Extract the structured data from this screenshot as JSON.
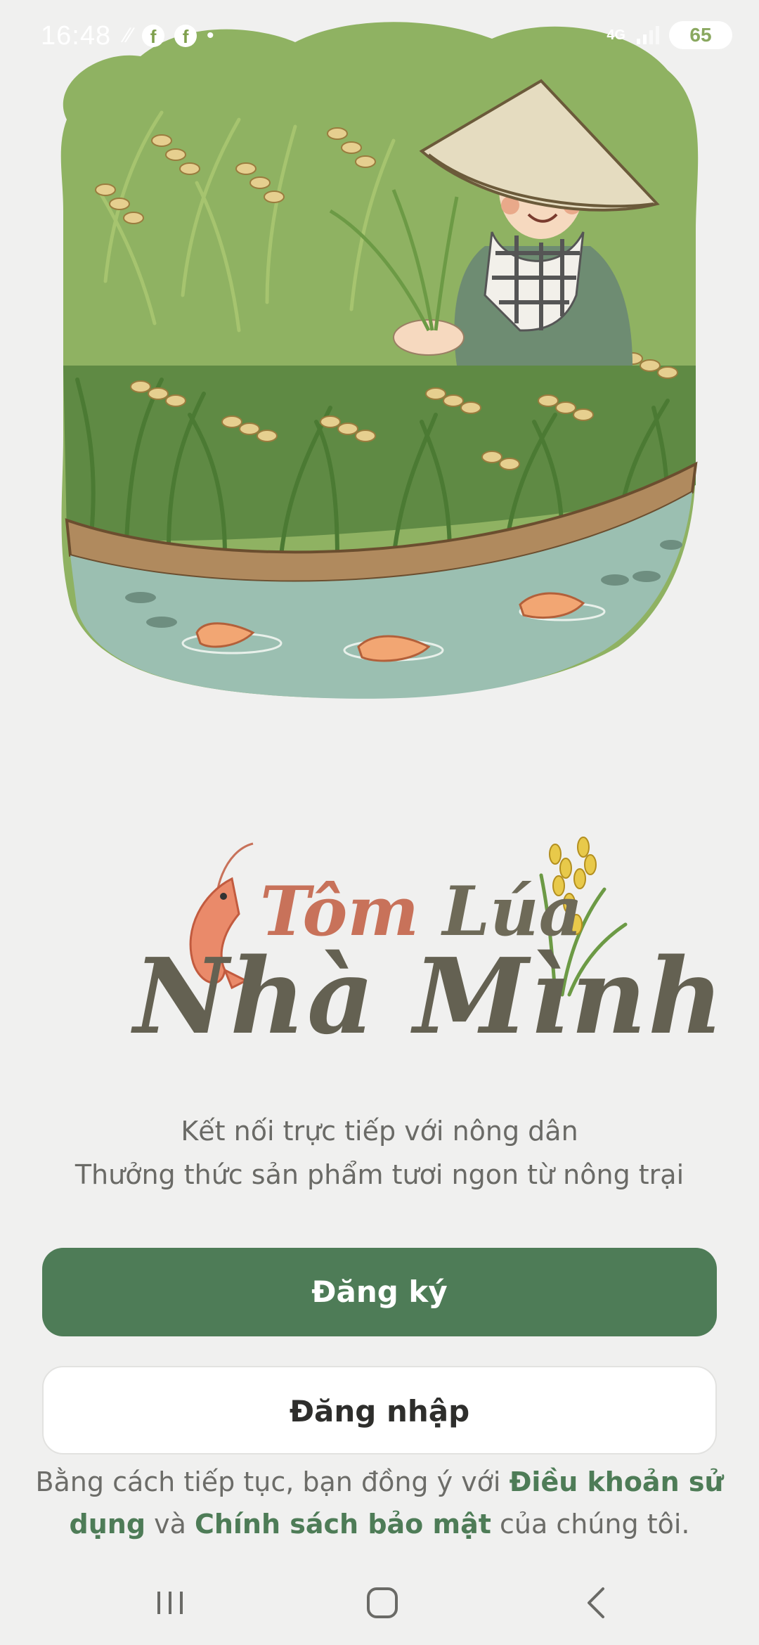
{
  "status_bar": {
    "time": "16:48",
    "network_label": "4G",
    "battery": "65",
    "icons": [
      "data-icon",
      "facebook-icon",
      "facebook-icon",
      "dot-icon",
      "signal-icon",
      "battery-icon"
    ]
  },
  "hero": {
    "illustration": "farmer-rice-field-shrimp-illustration"
  },
  "logo": {
    "line1_word1": "Tôm",
    "line1_word2": "Lúa",
    "line2": "Nhà Mình"
  },
  "tagline": {
    "line1": "Kết nối trực tiếp với nông dân",
    "line2": "Thưởng thức sản phẩm tươi ngon từ nông trại"
  },
  "buttons": {
    "register": "Đăng ký",
    "login": "Đăng nhập"
  },
  "terms": {
    "prefix": "Bằng cách tiếp tục, bạn đồng ý với ",
    "terms_link": "Điều khoản sử dụng",
    "conjunction": " và ",
    "privacy_link": "Chính sách bảo mật",
    "suffix": " của chúng tôi."
  },
  "colors": {
    "primary": "#4e7c57",
    "background": "#f0f0ef",
    "logo_accent": "#c8725a",
    "logo_dark": "#646152"
  },
  "nav_bar": {
    "icons": [
      "recents-icon",
      "home-icon",
      "back-icon"
    ]
  }
}
